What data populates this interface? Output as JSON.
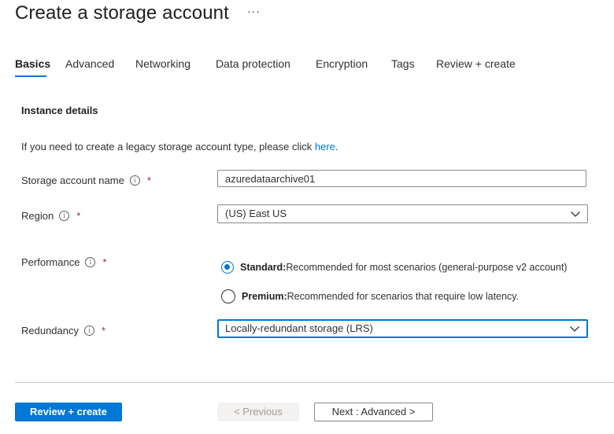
{
  "page": {
    "title": "Create a storage account",
    "more_label": "···"
  },
  "tabs": [
    {
      "label": "Basics",
      "active": true
    },
    {
      "label": "Advanced",
      "active": false
    },
    {
      "label": "Networking",
      "active": false
    },
    {
      "label": "Data protection",
      "active": false
    },
    {
      "label": "Encryption",
      "active": false
    },
    {
      "label": "Tags",
      "active": false
    },
    {
      "label": "Review + create",
      "active": false
    }
  ],
  "section": {
    "title": "Instance details",
    "legacy_text": "If you need to create a legacy storage account type, please click ",
    "legacy_link": "here",
    "legacy_end": "."
  },
  "fields": {
    "storage_name": {
      "label": "Storage account name",
      "value": "azuredataarchive01",
      "required": "*"
    },
    "region": {
      "label": "Region",
      "value": "(US) East US",
      "required": "*"
    },
    "performance": {
      "label": "Performance",
      "required": "*",
      "options": [
        {
          "title": "Standard:",
          "desc": " Recommended for most scenarios (general-purpose v2 account)",
          "checked": true
        },
        {
          "title": "Premium:",
          "desc": " Recommended for scenarios that require low latency.",
          "checked": false
        }
      ]
    },
    "redundancy": {
      "label": "Redundancy",
      "value": "Locally-redundant storage (LRS)",
      "required": "*"
    }
  },
  "footer": {
    "review_create": "Review + create",
    "previous": "< Previous",
    "next": "Next : Advanced >"
  },
  "icons": {
    "info": "info-icon",
    "chevron": "chevron-down-icon"
  },
  "colors": {
    "accent": "#0078d4",
    "required": "#a4262c"
  }
}
